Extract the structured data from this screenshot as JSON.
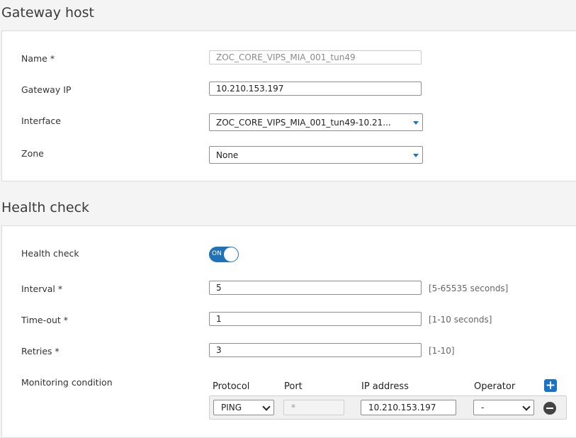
{
  "gateway": {
    "title": "Gateway host",
    "name_label": "Name *",
    "name_value": "ZOC_CORE_VIPS_MIA_001_tun49",
    "ip_label": "Gateway IP",
    "ip_value": "10.210.153.197",
    "interface_label": "Interface",
    "interface_value": "ZOC_CORE_VIPS_MIA_001_tun49-10.21...",
    "zone_label": "Zone",
    "zone_value": "None"
  },
  "health": {
    "title": "Health check",
    "check_label": "Health check",
    "toggle_text": "ON",
    "interval_label": "Interval *",
    "interval_value": "5",
    "interval_hint": "[5-65535 seconds]",
    "timeout_label": "Time-out *",
    "timeout_value": "1",
    "timeout_hint": "[1-10 seconds]",
    "retries_label": "Retries *",
    "retries_value": "3",
    "retries_hint": "[1-10]",
    "monitoring_label": "Monitoring condition",
    "columns": {
      "protocol": "Protocol",
      "port": "Port",
      "ip": "IP address",
      "operator": "Operator"
    },
    "row": {
      "protocol": "PING",
      "port_placeholder": "*",
      "ip": "10.210.153.197",
      "operator": "-"
    }
  },
  "colors": {
    "accent": "#1a73c4",
    "toggle_on": "#1f72b8"
  }
}
